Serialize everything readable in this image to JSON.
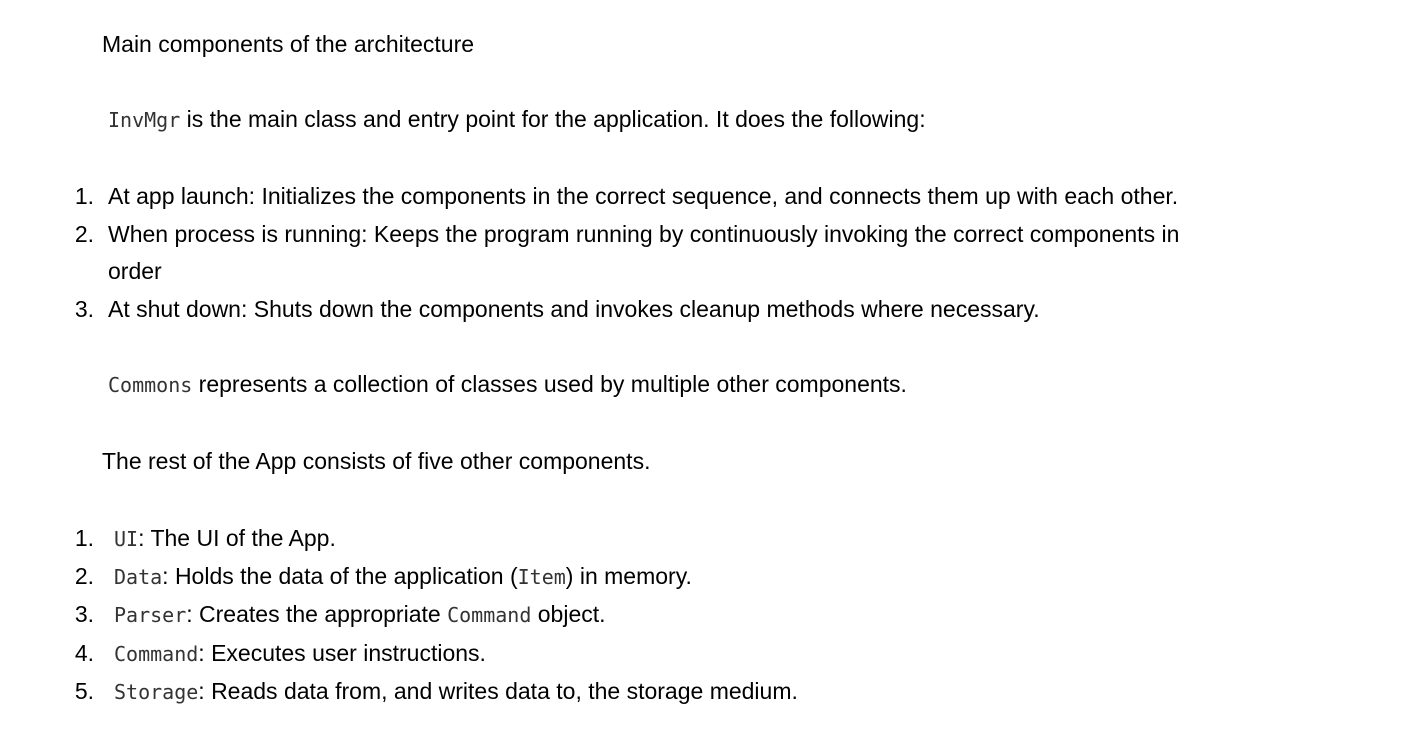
{
  "heading": "Main components of the architecture",
  "invmgr": {
    "code": "InvMgr",
    "text": " is the main class and entry point for the application. It does the following:"
  },
  "invmgr_list": [
    {
      "num": "1.",
      "text": "At app launch: Initializes the components in the correct sequence, and connects them up with each other."
    },
    {
      "num": "2.",
      "text": "When process is running: Keeps the program running by continuously invoking the correct components in",
      "text2": "order"
    },
    {
      "num": "3.",
      "text": "At shut down: Shuts down the components and invokes cleanup methods where necessary."
    }
  ],
  "commons": {
    "code": "Commons",
    "text": " represents a collection of classes used by multiple other components."
  },
  "rest_text": "The rest of the App consists of five other components.",
  "components": [
    {
      "num": "1.",
      "code": "UI",
      "text": ": The UI of the App."
    },
    {
      "num": "2.",
      "code": "Data",
      "text": ": Holds the data of the application (",
      "code2": "Item",
      "text2": ") in memory."
    },
    {
      "num": "3.",
      "code": "Parser",
      "text": ": Creates the appropriate ",
      "code2": "Command",
      "text2": " object."
    },
    {
      "num": "4.",
      "code": "Command",
      "text": ": Executes user instructions."
    },
    {
      "num": "5.",
      "code": "Storage",
      "text": ": Reads data from, and writes data to, the storage medium."
    }
  ]
}
